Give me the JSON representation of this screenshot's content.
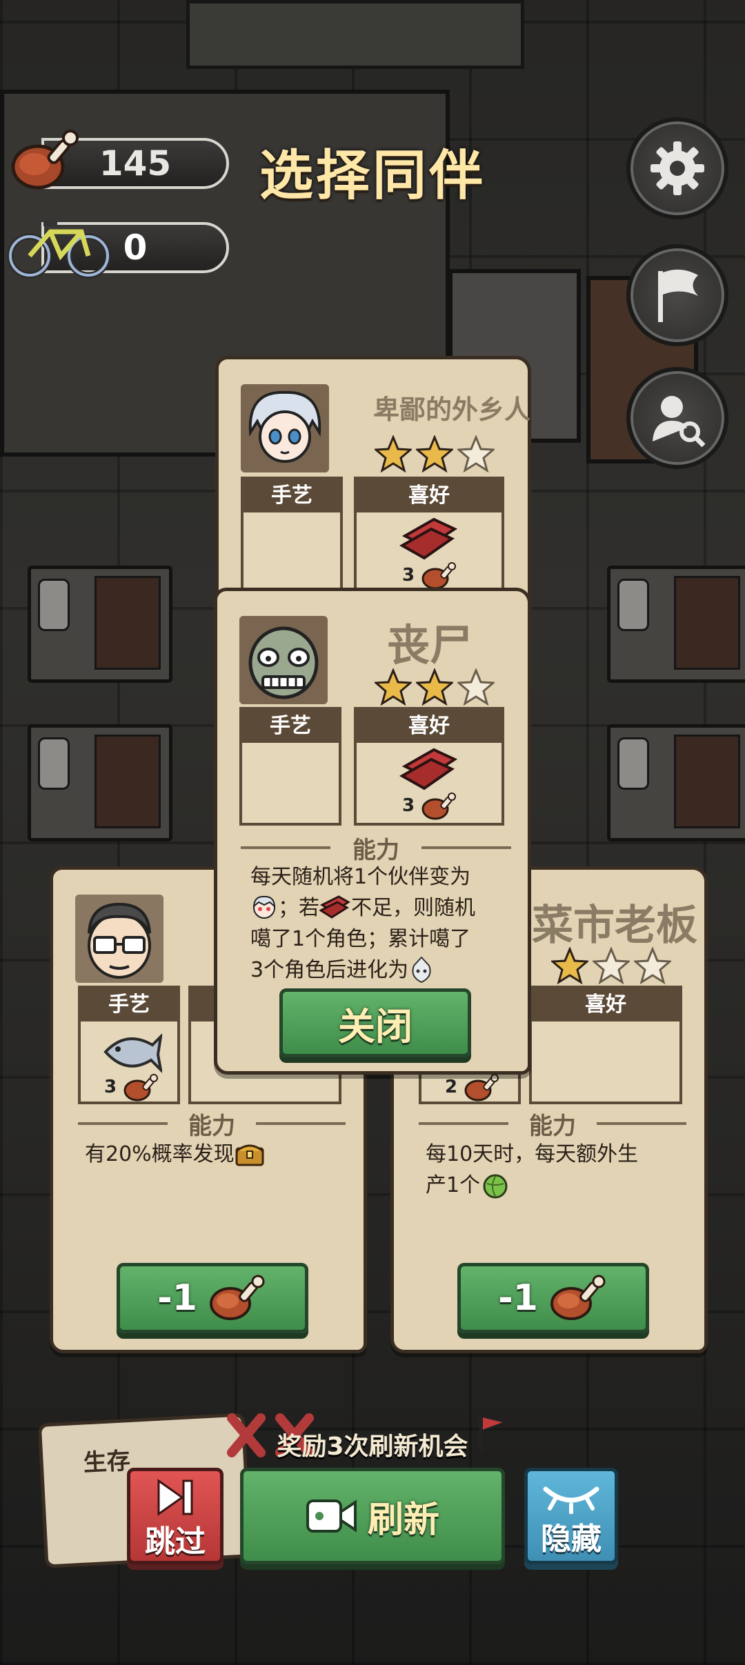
{
  "title": "选择同伴",
  "resources": {
    "meat": "145",
    "bikes": "0"
  },
  "reward_text": "奖励3次刷新机会",
  "buttons": {
    "skip": "跳过",
    "refresh": "刷新",
    "hide": "隐藏",
    "close": "关闭"
  },
  "cards": {
    "top": {
      "name": "卑鄙的外乡人",
      "stars": 2,
      "skill_label": "手艺",
      "like_label": "喜好",
      "like_cost": "3"
    },
    "zombie": {
      "name": "丧尸",
      "stars": 2,
      "skill_label": "手艺",
      "like_label": "喜好",
      "like_cost": "3",
      "ability_label": "能力",
      "ability_lines": [
        "每天随机将1个伙伴变为",
        "；若",
        "不足，则随机",
        "噶了1个角色；累计噶了",
        "3个角色后进化为"
      ]
    },
    "left": {
      "skill_label": "手艺",
      "skill_cost": "3",
      "ability_label": "能力",
      "ability": "有20%概率发现",
      "price": "-1"
    },
    "right": {
      "name": "菜市老板",
      "stars": 1,
      "like_label": "喜好",
      "skill_cost": "2",
      "ability_label": "能力",
      "ability_line1": "每10天时，每天额外生",
      "ability_line2": "产1个",
      "price": "-1"
    }
  },
  "bottom_left_hint": "生存"
}
